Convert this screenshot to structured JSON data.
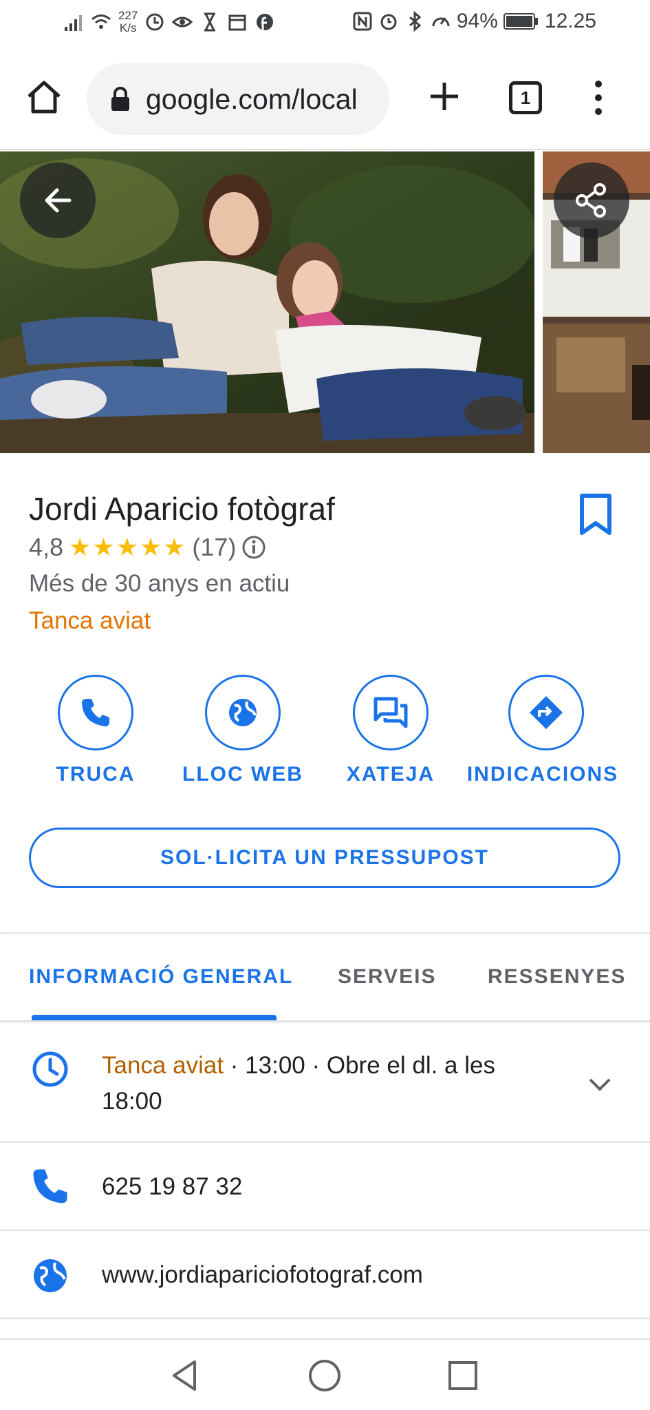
{
  "status_bar": {
    "net_speed_value": "227",
    "net_speed_unit": "K/s",
    "battery": "94%",
    "time": "12.25"
  },
  "browser": {
    "url": "google.com/local",
    "tab_count": "1"
  },
  "place": {
    "name": "Jordi Aparicio fotògraf",
    "rating": "4,8",
    "stars": "★★★★★",
    "stars_value": 4.8,
    "review_count": "(17)",
    "subtitle": "Més de 30 anys en actiu",
    "status": "Tanca aviat"
  },
  "actions": {
    "call": "TRUCA",
    "website": "LLOC WEB",
    "chat": "XATEJA",
    "directions": "INDICACIONS",
    "quote": "SOL·LICITA UN PRESSUPOST"
  },
  "tabs": [
    "INFORMACIÓ GENERAL",
    "SERVEIS",
    "RESSENYES"
  ],
  "info": {
    "hours_status": "Tanca aviat",
    "hours_line1_rest": " · 13:00 · Obre el dl. a les",
    "hours_line2": "18:00",
    "phone": "625 19 87 32",
    "website": "www.jordiapariciofotograf.com"
  },
  "colors": {
    "accent": "#1a73e8",
    "closing": "#e37400",
    "star": "#fbbc04"
  },
  "icons": {
    "back": "arrow-left-icon",
    "share": "share-icon",
    "bookmark": "bookmark-icon",
    "call": "phone-icon",
    "website": "globe-icon",
    "chat": "chat-icon",
    "directions": "directions-icon",
    "hours": "clock-icon"
  }
}
